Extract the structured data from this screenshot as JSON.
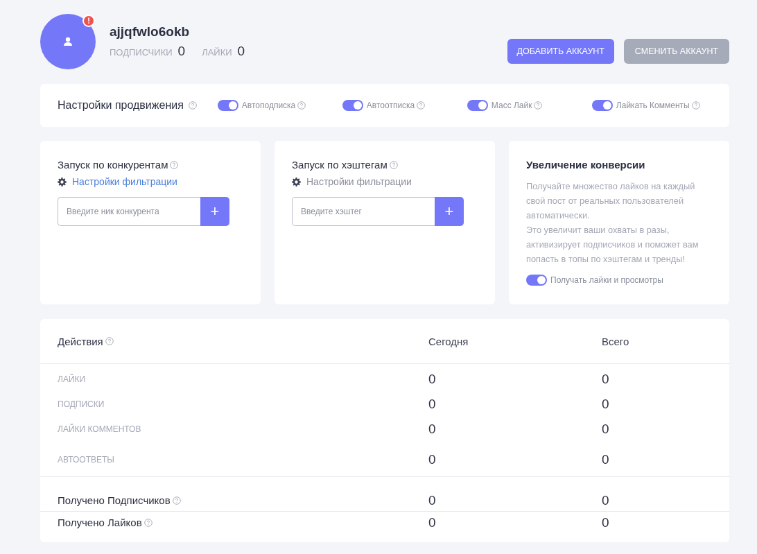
{
  "profile": {
    "username": "ajjqfwlo6okb",
    "alert": true,
    "stats": [
      {
        "label": "ПОДПИСЧИКИ",
        "value": "0"
      },
      {
        "label": "ЛАЙКИ",
        "value": "0"
      }
    ]
  },
  "header_buttons": [
    {
      "label": "ДОБАВИТЬ АККАУНТ",
      "disabled": false
    },
    {
      "label": "СМЕНИТЬ АККАУНТ",
      "disabled": true
    }
  ],
  "promotion": {
    "title": "Настройки продвижения",
    "toggles": [
      {
        "label": "Автоподписка",
        "on": true
      },
      {
        "label": "Автоотписка",
        "on": true
      },
      {
        "label": "Масс Лайк",
        "on": true
      },
      {
        "label": "Лайкать Комменты",
        "on": true
      }
    ]
  },
  "cards": [
    {
      "kind": "input",
      "title": "Запуск по конкурентам",
      "help": true,
      "filter_link": "Настройки фильтрации",
      "filter_active": true,
      "placeholder": "Введите ник конкурента",
      "add_button": "+"
    },
    {
      "kind": "input",
      "title": "Запуск по хэштегам",
      "help": true,
      "filter_link": "Настройки фильтрации",
      "filter_active": false,
      "placeholder": "Введите хэштег",
      "add_button": "+"
    },
    {
      "kind": "info",
      "title": "Увеличение конверсии",
      "help": false,
      "paragraphs": [
        "Получайте множество лайков на каждый свой пост от реальных пользователей автоматически.",
        "Это увеличит ваши охваты в разы, активизирует подписчиков и поможет вам попасть в топы по хэштегам и тренды!"
      ],
      "toggle": {
        "label": "Получать лайки и просмотры",
        "on": true
      }
    }
  ],
  "table": {
    "columns": [
      "Действия",
      "Сегодня",
      "Всего"
    ],
    "rows": [
      {
        "kind": "small",
        "label": "ЛАЙКИ",
        "today": "0",
        "total": "0"
      },
      {
        "kind": "small",
        "label": "ПОДПИСКИ",
        "today": "0",
        "total": "0"
      },
      {
        "kind": "small",
        "label": "ЛАЙКИ КОММЕНТОВ",
        "today": "0",
        "total": "0"
      },
      {
        "kind": "small",
        "label": "АВТООТВЕТЫ",
        "today": "0",
        "total": "0"
      },
      {
        "kind": "summary",
        "label": "Получено Подписчиков",
        "today": "0",
        "total": "0"
      },
      {
        "kind": "summary",
        "label": "Получено Лайков",
        "today": "0",
        "total": "0"
      }
    ]
  }
}
